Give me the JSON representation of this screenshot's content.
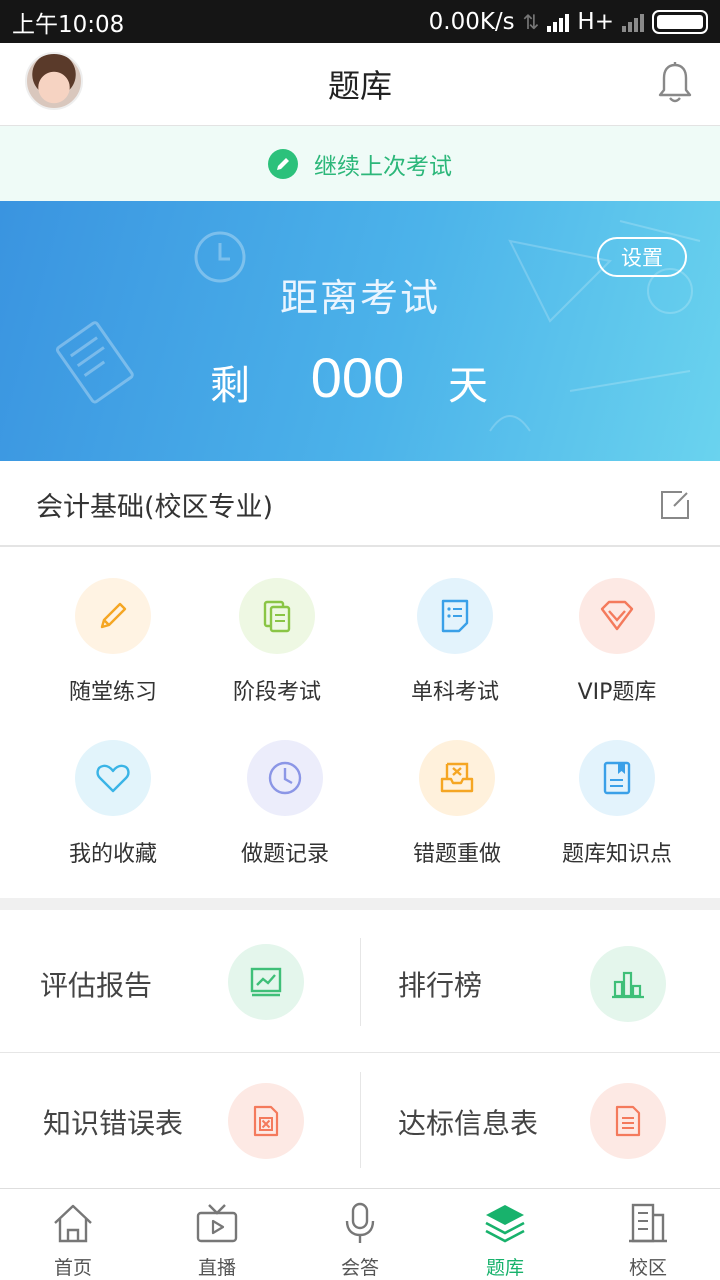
{
  "status_bar": {
    "time": "上午10:08",
    "speed": "0.00K/s",
    "network": "H+"
  },
  "header": {
    "title": "题库"
  },
  "continue_bar": {
    "label": "继续上次考试"
  },
  "countdown": {
    "title": "距离考试",
    "prefix": "剩",
    "days": "000",
    "suffix": "天",
    "settings_label": "设置"
  },
  "subject": {
    "name": "会计基础(校区专业)"
  },
  "features": [
    {
      "label": "随堂练习",
      "icon": "pencil-icon",
      "color": "#f5a623",
      "bg": "#fff3e3"
    },
    {
      "label": "阶段考试",
      "icon": "documents-icon",
      "color": "#8ac545",
      "bg": "#eef8e3"
    },
    {
      "label": "单科考试",
      "icon": "checklist-icon",
      "color": "#3aa0e8",
      "bg": "#e3f3fc"
    },
    {
      "label": "VIP题库",
      "icon": "diamond-icon",
      "color": "#f47a5c",
      "bg": "#fde9e4"
    },
    {
      "label": "我的收藏",
      "icon": "heart-icon",
      "color": "#3ab4e6",
      "bg": "#e2f4fb"
    },
    {
      "label": "做题记录",
      "icon": "clock-icon",
      "color": "#8b96e6",
      "bg": "#ecedfb"
    },
    {
      "label": "错题重做",
      "icon": "tray-x-icon",
      "color": "#f5a623",
      "bg": "#fff1dc"
    },
    {
      "label": "题库知识点",
      "icon": "book-icon",
      "color": "#3aa0e8",
      "bg": "#e3f3fc"
    }
  ],
  "cells": [
    {
      "label": "评估报告",
      "icon": "chart-icon",
      "color": "#3fbf78",
      "bg": "#e4f6ec"
    },
    {
      "label": "排行榜",
      "icon": "bars-icon",
      "color": "#3fbf78",
      "bg": "#e4f6ec"
    },
    {
      "label": "知识错误表",
      "icon": "error-sheet-icon",
      "color": "#f47a5c",
      "bg": "#fde9e4"
    },
    {
      "label": "达标信息表",
      "icon": "info-sheet-icon",
      "color": "#f47a5c",
      "bg": "#fde9e4"
    }
  ],
  "tabs": [
    {
      "label": "首页",
      "icon": "home-icon"
    },
    {
      "label": "直播",
      "icon": "tv-icon"
    },
    {
      "label": "会答",
      "icon": "microphone-icon"
    },
    {
      "label": "题库",
      "icon": "layers-icon",
      "active": true
    },
    {
      "label": "校区",
      "icon": "building-icon"
    }
  ],
  "colors": {
    "accent": "#18b26c",
    "banner_start": "#3a94e0",
    "banner_end": "#6ad3ee"
  }
}
